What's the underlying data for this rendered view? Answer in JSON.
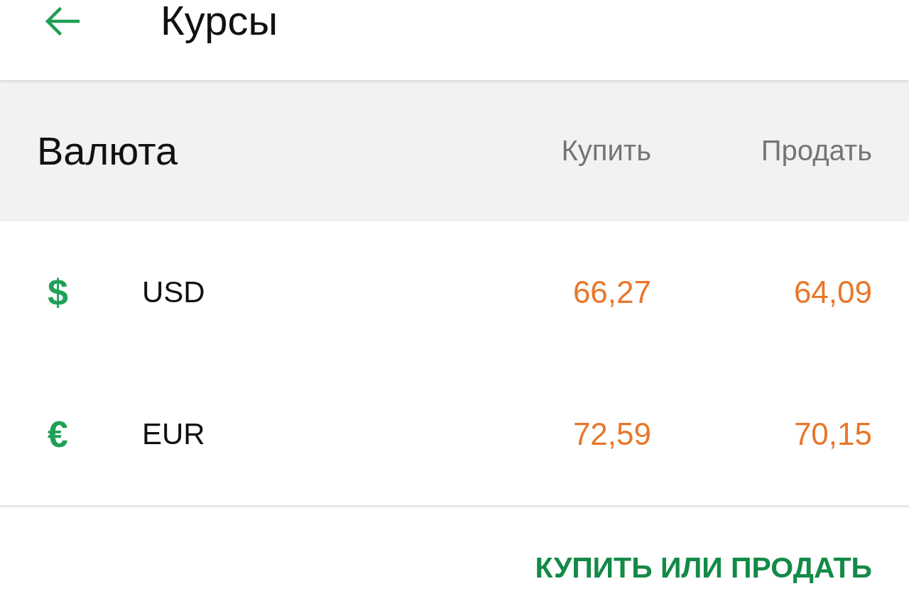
{
  "header": {
    "title": "Курсы"
  },
  "table": {
    "columns": [
      {
        "label": "Валюта"
      },
      {
        "label": "Купить"
      },
      {
        "label": "Продать"
      }
    ],
    "rows": [
      {
        "symbol": "$",
        "code": "USD",
        "buy": "66,27",
        "sell": "64,09"
      },
      {
        "symbol": "€",
        "code": "EUR",
        "buy": "72,59",
        "sell": "70,15"
      }
    ]
  },
  "action_button": {
    "label": "КУПИТЬ ИЛИ ПРОДАТЬ"
  }
}
